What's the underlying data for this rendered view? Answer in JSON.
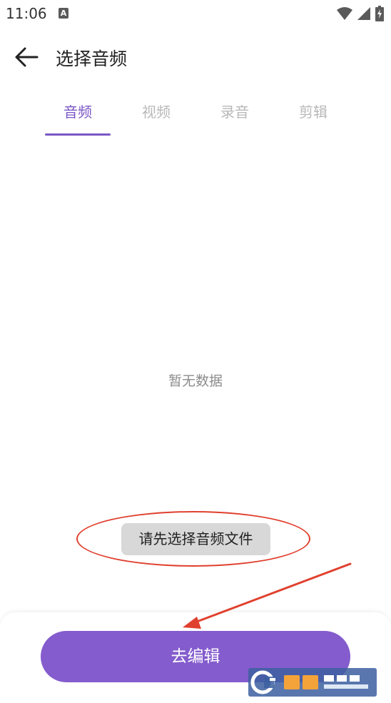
{
  "status_bar": {
    "time": "11:06",
    "notification_icon": "a-text-icon",
    "icons": [
      "wifi-icon",
      "signal-icon",
      "battery-icon"
    ]
  },
  "app_bar": {
    "title": "选择音频",
    "back_icon": "arrow-left-icon"
  },
  "tabs": [
    {
      "label": "音频",
      "active": true
    },
    {
      "label": "视频",
      "active": false
    },
    {
      "label": "录音",
      "active": false
    },
    {
      "label": "剪辑",
      "active": false
    }
  ],
  "content": {
    "empty_text": "暂无数据"
  },
  "toast": {
    "message": "请先选择音频文件"
  },
  "bottom": {
    "edit_button_label": "去编辑"
  },
  "colors": {
    "accent": "#7b57c6",
    "button": "#845ccd",
    "annotation": "#e0402e",
    "tab_inactive": "#b8b8b8"
  },
  "watermark": {
    "icon": "cr173-logo-watermark"
  }
}
